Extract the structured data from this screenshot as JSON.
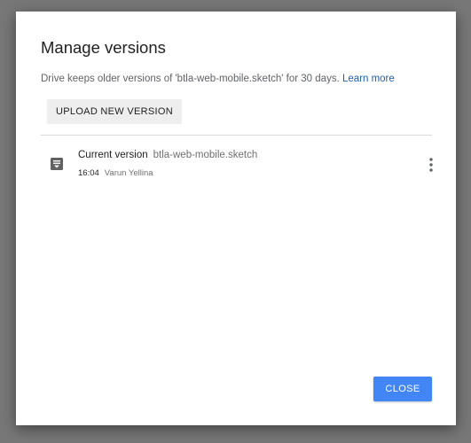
{
  "dialog": {
    "title": "Manage versions",
    "description": "Drive keeps older versions of 'btla-web-mobile.sketch' for 30 days.",
    "learn_more": "Learn more",
    "upload_label": "UPLOAD NEW VERSION",
    "close_label": "CLOSE"
  },
  "versions": [
    {
      "label": "Current version",
      "file_name": "btla-web-mobile.sketch",
      "time": "16:04",
      "author": "Varun Yellina",
      "icon": "document-icon"
    }
  ],
  "colors": {
    "overlay": "#777777",
    "primary": "#4285f4",
    "link": "#1a5fb4"
  }
}
